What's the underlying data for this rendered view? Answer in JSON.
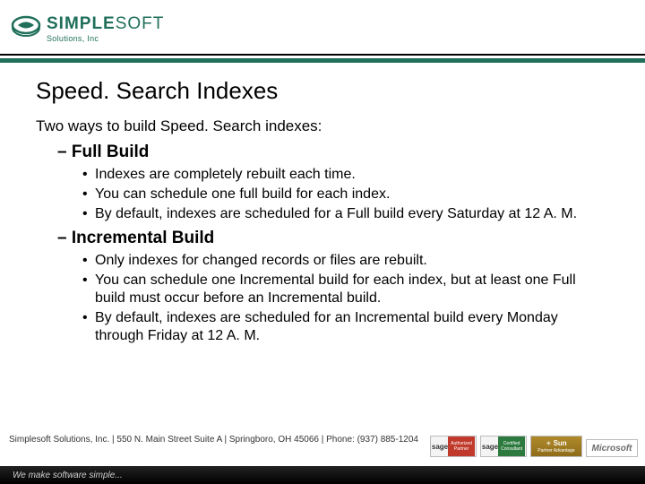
{
  "brand": {
    "name_main": "SIMPLE",
    "name_soft": "SOFT",
    "subline": "Solutions, Inc"
  },
  "slide": {
    "title": "Speed. Search Indexes",
    "intro": "Two ways to build Speed. Search indexes:",
    "sections": [
      {
        "label": "Full Build",
        "bullets": [
          "Indexes are completely rebuilt each time.",
          "You can schedule one full build for each index.",
          "By default, indexes are scheduled for a Full build every Saturday at 12 A. M."
        ]
      },
      {
        "label": "Incremental Build",
        "bullets": [
          "Only indexes for changed records or files are rebuilt.",
          "You can schedule one Incremental build for each index, but at least one Full build must occur before an Incremental build.",
          "By default, indexes are scheduled for an Incremental build every Monday through Friday at 12 A. M."
        ]
      }
    ]
  },
  "footer": {
    "info": "Simplesoft Solutions, Inc.  |  550 N. Main Street Suite A  |  Springboro, OH 45066  |  Phone: (937) 885-1204",
    "tagline": "We make software simple..."
  },
  "badges": {
    "sage1": "sage",
    "sage1_sub": "Authorized Partner",
    "sage2": "sage",
    "sage2_sub": "Certified Consultant",
    "sun": "Sun",
    "sun_sub": "Partner Advantage",
    "ms": "Microsoft"
  }
}
